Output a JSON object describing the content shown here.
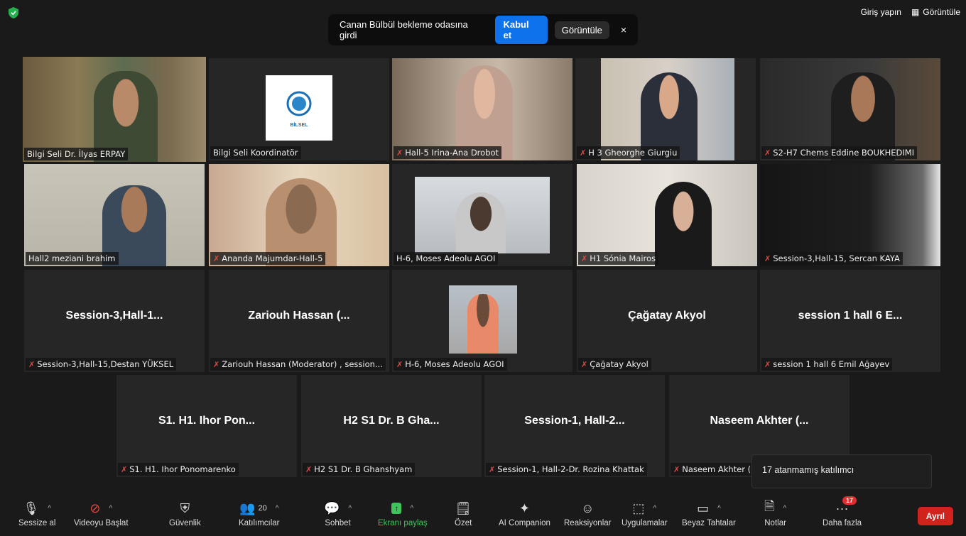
{
  "window": {
    "sign_in": "Giriş yapın",
    "view": "Görüntüle"
  },
  "notification": {
    "message": "Canan Bülbül bekleme odasına girdi",
    "accept": "Kabul et",
    "view": "Görüntüle",
    "close": "×"
  },
  "participants": [
    {
      "name": "Bilgi Seli Dr. İlyas ERPAY",
      "muted": false,
      "video": true,
      "active": true
    },
    {
      "name": "Bilgi Seli Koordinatör",
      "muted": false,
      "video": true,
      "logo_text": "BİLSEL"
    },
    {
      "name": "Hall-5 Irina-Ana Drobot",
      "muted": true,
      "video": true
    },
    {
      "name": "H 3 Gheorghe Giurgiu",
      "muted": true,
      "video": true
    },
    {
      "name": "S2-H7  Chems Eddine BOUKHEDIMI",
      "muted": true,
      "video": true
    },
    {
      "name": "Hall2 meziani brahim",
      "muted": false,
      "video": true
    },
    {
      "name": "Ananda Majumdar-Hall-5",
      "muted": true,
      "video": true
    },
    {
      "name": "H-6, Moses Adeolu AGOI",
      "muted": false,
      "video": true
    },
    {
      "name": "H1 Sónia Mairos",
      "muted": true,
      "video": true
    },
    {
      "name": "Session-3,Hall-15, Sercan KAYA",
      "muted": true,
      "video": true
    },
    {
      "name": "Session-3,Hall-15,Destan YÜKSEL",
      "display": "Session-3,Hall-1...",
      "muted": true,
      "video": false
    },
    {
      "name": "Zariouh Hassan (Moderator) , session...",
      "display": "Zariouh Hassan (...",
      "muted": true,
      "video": false
    },
    {
      "name": "H-6, Moses Adeolu AGOI",
      "muted": true,
      "video": false,
      "avatar": true
    },
    {
      "name": "Çağatay Akyol",
      "display": "Çağatay Akyol",
      "muted": true,
      "video": false
    },
    {
      "name": "session 1 hall 6 Emil Ağayev",
      "display": "session 1 hall 6 E...",
      "muted": true,
      "video": false
    },
    {
      "name": "S1. H1. Ihor Ponomarenko",
      "display": "S1. H1. Ihor Pon...",
      "muted": true,
      "video": false
    },
    {
      "name": "H2 S1 Dr. B Ghanshyam",
      "display": "H2 S1 Dr. B Gha...",
      "muted": true,
      "video": false
    },
    {
      "name": "Session-1, Hall-2-Dr. Rozina Khattak",
      "display": "Session-1,  Hall-2...",
      "muted": true,
      "video": false
    },
    {
      "name": "Naseem Akhter (",
      "display": "Naseem Akhter (...",
      "muted": true,
      "video": false
    }
  ],
  "tooltip": "17 atanmamış katılımcı",
  "toolbar": {
    "mute": "Sessize al",
    "video": "Videoyu Başlat",
    "security": "Güvenlik",
    "participants": "Katılımcılar",
    "participants_count": "20",
    "chat": "Sohbet",
    "share": "Ekranı paylaş",
    "summary": "Özet",
    "ai": "AI Companion",
    "reactions": "Reaksiyonlar",
    "apps": "Uygulamalar",
    "whiteboards": "Beyaz Tahtalar",
    "notes": "Notlar",
    "more": "Daha fazla",
    "more_badge": "17",
    "leave": "Ayrıl"
  },
  "colors": {
    "accept": "#0e72ed",
    "leave": "#d0231d",
    "active_border": "#d3e97a",
    "share_green": "#3fc35b",
    "muted_red": "#e5483e"
  }
}
